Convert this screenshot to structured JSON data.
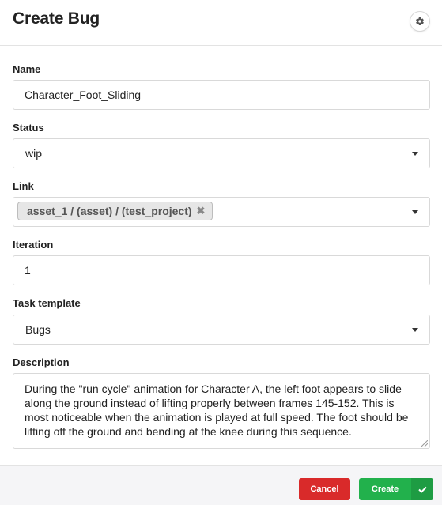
{
  "header": {
    "title": "Create Bug",
    "settings_icon": "gear-icon"
  },
  "form": {
    "name": {
      "label": "Name",
      "value": "Character_Foot_Sliding"
    },
    "status": {
      "label": "Status",
      "value": "wip"
    },
    "link": {
      "label": "Link",
      "tag": "asset_1 / (asset) / (test_project)",
      "remove_icon": "close-icon"
    },
    "iteration": {
      "label": "Iteration",
      "value": "1"
    },
    "task_template": {
      "label": "Task template",
      "value": "Bugs"
    },
    "description": {
      "label": "Description",
      "value": "During the \"run cycle\" animation for Character A, the left foot appears to slide along the ground instead of lifting properly between frames 145-152. This is most noticeable when the animation is played at full speed. The foot should be lifting off the ground and bending at the knee during this sequence."
    }
  },
  "footer": {
    "cancel_label": "Cancel",
    "create_label": "Create",
    "create_icon": "check-icon"
  },
  "colors": {
    "cancel": "#d92a2a",
    "create": "#22b14c",
    "create_dark": "#1e9c43"
  }
}
